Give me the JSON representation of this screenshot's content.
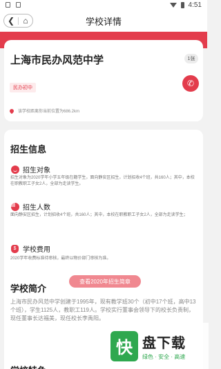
{
  "status_bar": {
    "time": "4:51"
  },
  "nav": {
    "title": "学校详情",
    "back_icon": "back-icon",
    "home_icon": "home-icon"
  },
  "school": {
    "name": "上海市民办风范中学",
    "count_badge": "1张",
    "type_tag": "民办初中",
    "distance": "该学校距离你当前位置为686.2km",
    "accent_color": "#e33c4c"
  },
  "admission": {
    "title": "招生信息",
    "target": {
      "label": "招生对象",
      "desc": "招生对象为2020学年小学五年级在籍学生，面向静安区招生，计划招收4个班，共160人；其中，本校在职教职工子女2人，全部为走读学生。"
    },
    "count": {
      "label": "招生人数",
      "desc": "面向静安区招生，计划招收4个班，共160人；其中，本校在职教职工子女2人，全部为走读学生；"
    },
    "fee": {
      "label": "学校费用",
      "desc": "2020学年收费标准待审核，最终以物价部门审核为准。"
    },
    "cta_label": "查看2020年招生简章"
  },
  "intro": {
    "title": "学校简介",
    "text": "上海市民办风范中学创建于1995年，现有教学班30个（初中17个班，高中13个班），学生1125人，教职工119人。学校实行董事会领导下的校长负责制，现任董事长达福美，现任校长李禹阳。"
  },
  "next_section": {
    "title": "学校特色"
  },
  "watermark": {
    "main": "盘下载",
    "sub": "绿色 · 安全 · 高速",
    "logo_char": "快"
  }
}
